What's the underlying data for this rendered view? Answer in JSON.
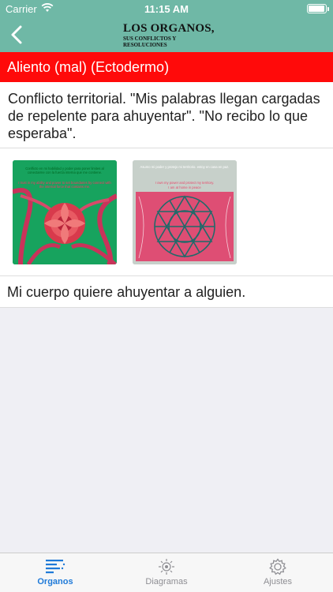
{
  "status_bar": {
    "carrier": "Carrier",
    "time": "11:15 AM",
    "battery_level": 0.95
  },
  "nav": {
    "logo_title": "LOS ORGANOS,",
    "logo_subtitle_1": "SUS CONFLICTOS Y",
    "logo_subtitle_2": "RESOLUCIONES"
  },
  "header": {
    "title": "Aliento (mal)  (Ectodermo)"
  },
  "content": {
    "description": "Conflicto territorial.  \"Mis palabras llegan cargadas de repelente para ahuyentar\". \"No recibo lo que esperaba\".",
    "cards": [
      {
        "text_es": "Conflicto en mi habilidad y poder para poner limites al conectarme con la fuerza interna que me contiene.",
        "text_en": "I trust in my ability and power to set boundaries by connect with the internal force that contains me."
      },
      {
        "text_es": "Asumo mi poder y protejo mi territorio. estoy en casa en paz.",
        "text_en_1": "I own my power and protect my territory.",
        "text_en_2": "I am at home in peace"
      }
    ],
    "subtitle": "Mi cuerpo quiere ahuyentar a alguien."
  },
  "tabs": [
    {
      "label": "Organos",
      "icon": "list-icon",
      "active": true
    },
    {
      "label": "Diagramas",
      "icon": "diagram-icon",
      "active": false
    },
    {
      "label": "Ajustes",
      "icon": "gear-icon",
      "active": false
    }
  ],
  "colors": {
    "nav": "#6fb8a6",
    "header": "#ff0a0a",
    "tab_active": "#1f7ad8",
    "tab_inactive": "#8e8e93"
  }
}
